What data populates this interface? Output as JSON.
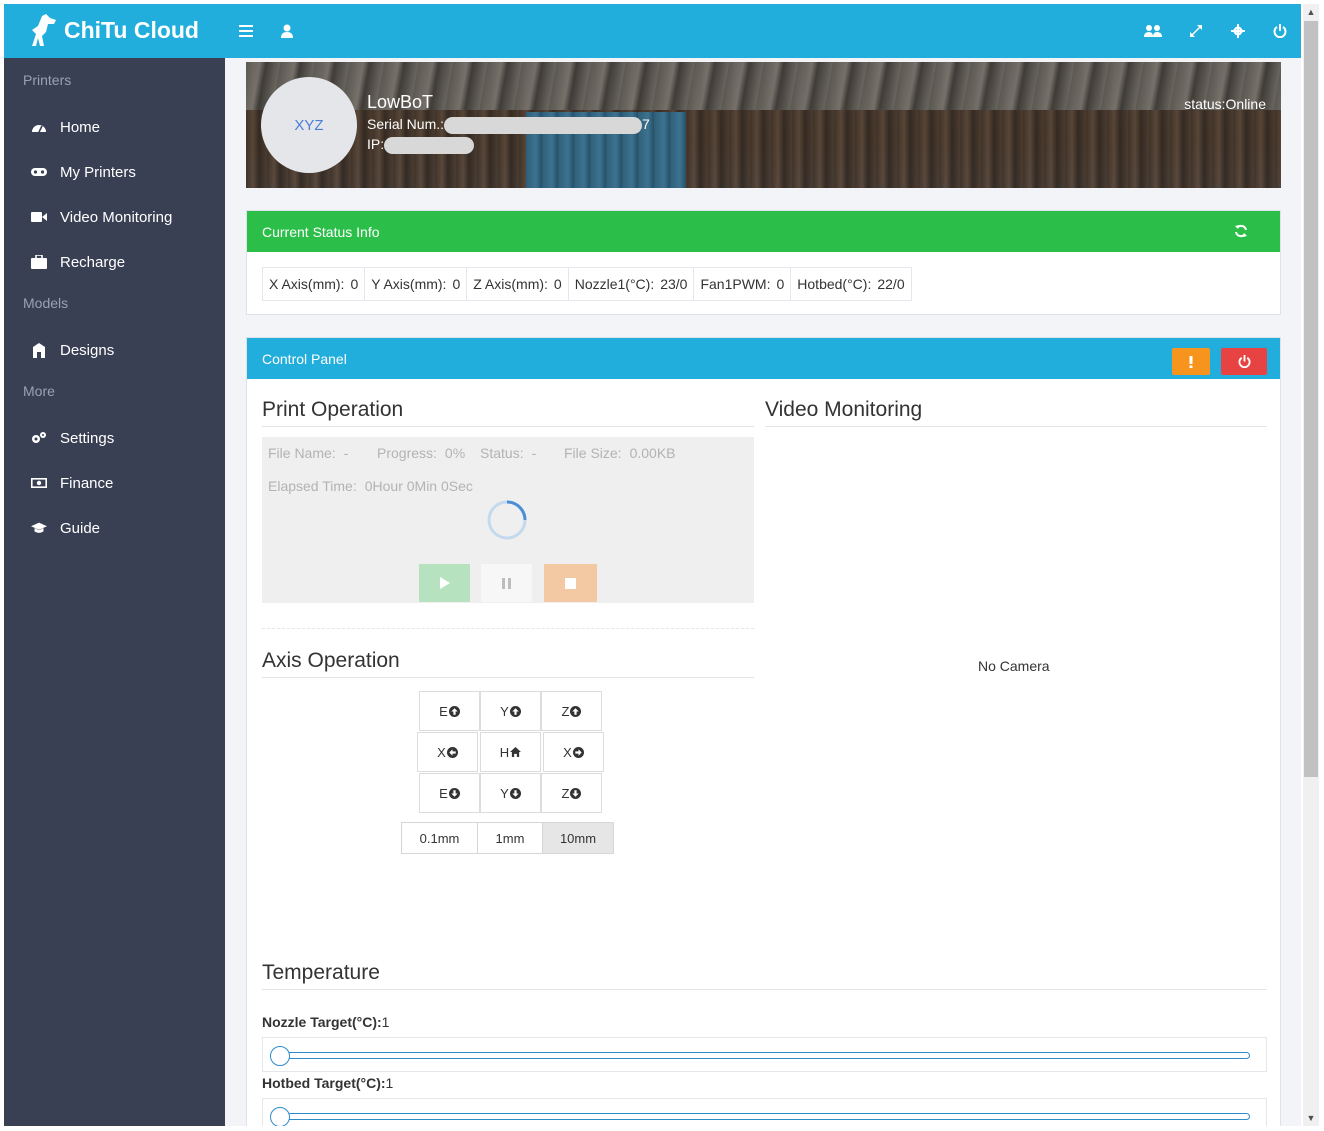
{
  "app": {
    "logo_text": "ChiTu Cloud"
  },
  "topbar": {
    "icons": [
      "menu-icon",
      "user-icon",
      "users-icon",
      "expand-icon",
      "gear-icon",
      "power-icon"
    ]
  },
  "sidebar": {
    "sections": [
      {
        "label": "Printers"
      },
      {
        "label": "Models"
      },
      {
        "label": "More"
      }
    ],
    "items": [
      {
        "label": "Home",
        "icon": "dashboard-icon"
      },
      {
        "label": "My Printers",
        "icon": "gamepad-icon"
      },
      {
        "label": "Video Monitoring",
        "icon": "video-icon"
      },
      {
        "label": "Recharge",
        "icon": "briefcase-icon"
      },
      {
        "label": "Designs",
        "icon": "cube-icon"
      },
      {
        "label": "Settings",
        "icon": "cogs-icon"
      },
      {
        "label": "Finance",
        "icon": "money-icon"
      },
      {
        "label": "Guide",
        "icon": "graduation-cap-icon"
      }
    ]
  },
  "printer": {
    "avatar_text": "XYZ",
    "name": "LowBoT",
    "serial_label": "Serial Num.:",
    "serial_suffix": "7",
    "ip_label": "IP:",
    "status": "status:Online"
  },
  "status_panel": {
    "title": "Current Status Info",
    "cells": [
      {
        "label": "X Axis(mm):",
        "value": "0"
      },
      {
        "label": "Y Axis(mm):",
        "value": "0"
      },
      {
        "label": "Z Axis(mm):",
        "value": "0"
      },
      {
        "label": "Nozzle1(°C):",
        "value": "23/0"
      },
      {
        "label": "Fan1PWM:",
        "value": "0"
      },
      {
        "label": "Hotbed(°C):",
        "value": "22/0"
      }
    ]
  },
  "control_panel": {
    "title": "Control Panel",
    "print_operation": {
      "title": "Print Operation",
      "file_name_label": "File Name:",
      "file_name": "-",
      "progress_label": "Progress:",
      "progress": "0%",
      "status_label": "Status:",
      "status": "-",
      "file_size_label": "File Size:",
      "file_size": "0.00KB",
      "elapsed_label": "Elapsed Time:",
      "elapsed": "0Hour 0Min 0Sec"
    },
    "axis_operation": {
      "title": "Axis Operation",
      "buttons": [
        {
          "label": "E",
          "icon": "arrow-up-circle-icon"
        },
        {
          "label": "Y",
          "icon": "arrow-up-circle-icon"
        },
        {
          "label": "Z",
          "icon": "arrow-up-circle-icon"
        },
        {
          "label": "X",
          "icon": "arrow-left-circle-icon"
        },
        {
          "label": "H",
          "icon": "home-icon"
        },
        {
          "label": "X",
          "icon": "arrow-right-circle-icon"
        },
        {
          "label": "E",
          "icon": "arrow-down-circle-icon"
        },
        {
          "label": "Y",
          "icon": "arrow-down-circle-icon"
        },
        {
          "label": "Z",
          "icon": "arrow-down-circle-icon"
        }
      ],
      "steps": [
        "0.1mm",
        "1mm",
        "10mm"
      ],
      "selected_step": "10mm"
    },
    "video_monitoring": {
      "title": "Video Monitoring",
      "no_camera": "No Camera"
    },
    "temperature": {
      "title": "Temperature",
      "nozzle_label": "Nozzle Target(°C):",
      "nozzle_value": "1",
      "hotbed_label": "Hotbed Target(°C):",
      "hotbed_value": "1"
    }
  },
  "colors": {
    "topbar": "#22aedc",
    "sidebar": "#394054",
    "status_header": "#2bbf4a",
    "control_header": "#22aedc",
    "warning": "#f7941d",
    "danger": "#e84343"
  }
}
